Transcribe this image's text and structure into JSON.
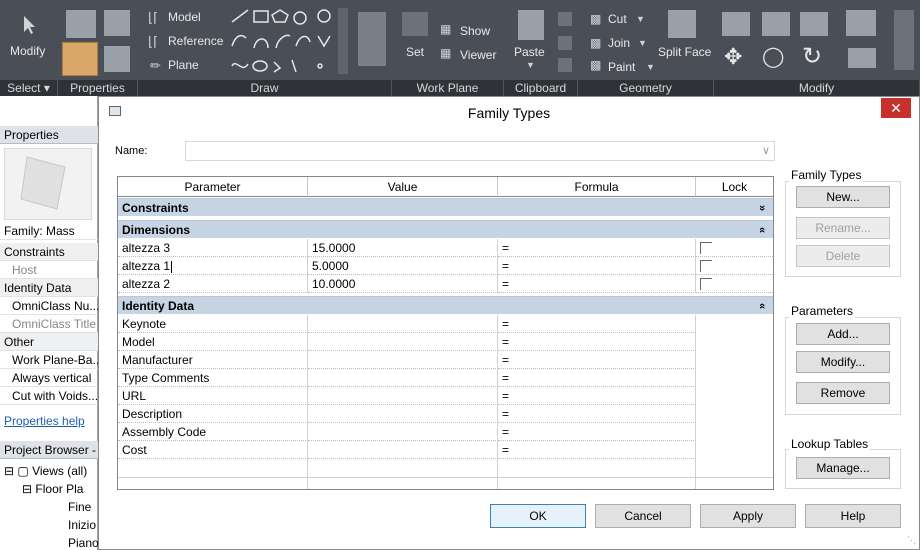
{
  "ribbon": {
    "modify_label": "Modify",
    "model_label": "Model",
    "reference_label": "Reference",
    "plane_label": "Plane",
    "show_label": "Show",
    "set_label": "Set",
    "viewer_label": "Viewer",
    "paste_label": "Paste",
    "cut_label": "Cut",
    "join_label": "Join",
    "paint_label": "Paint",
    "split_face_label": "Split Face",
    "groups": [
      "Select ▾",
      "Properties",
      "Draw",
      "Work Plane",
      "Clipboard",
      "Geometry",
      "Modify"
    ]
  },
  "properties_panel": {
    "title": "Properties",
    "family": "Family: Mass",
    "rows": [
      {
        "label": "Constraints",
        "kind": "cat"
      },
      {
        "label": "Host",
        "kind": "grey"
      },
      {
        "label": "Identity Data",
        "kind": "cat"
      },
      {
        "label": "OmniClass Nu...",
        "kind": "item"
      },
      {
        "label": "OmniClass Title",
        "kind": "grey"
      },
      {
        "label": "Other",
        "kind": "cat"
      },
      {
        "label": "Work Plane-Ba...",
        "kind": "item"
      },
      {
        "label": "Always vertical",
        "kind": "item"
      },
      {
        "label": "Cut with Voids...",
        "kind": "item"
      }
    ],
    "help_link": "Properties help"
  },
  "project_browser": {
    "title": "Project Browser - T",
    "items": [
      "Views (all)",
      "Floor Pla",
      "Fine",
      "Inizio",
      "Piano"
    ]
  },
  "dialog": {
    "title": "Family Types",
    "name_label": "Name:",
    "name_value": "",
    "columns": [
      "Parameter",
      "Value",
      "Formula",
      "Lock"
    ],
    "constraints_group": "Constraints",
    "dimensions_group": "Dimensions",
    "dimension_rows": [
      {
        "parameter": "altezza 3",
        "value": "15.0000",
        "formula": "="
      },
      {
        "parameter": "altezza 1",
        "value": "5.0000",
        "formula": "="
      },
      {
        "parameter": "altezza 2",
        "value": "10.0000",
        "formula": "="
      }
    ],
    "identity_group": "Identity Data",
    "identity_rows": [
      {
        "parameter": "Keynote",
        "formula": "="
      },
      {
        "parameter": "Model",
        "formula": "="
      },
      {
        "parameter": "Manufacturer",
        "formula": "="
      },
      {
        "parameter": "Type Comments",
        "formula": "="
      },
      {
        "parameter": "URL",
        "formula": "="
      },
      {
        "parameter": "Description",
        "formula": "="
      },
      {
        "parameter": "Assembly Code",
        "formula": "="
      },
      {
        "parameter": "Cost",
        "formula": "="
      }
    ],
    "family_types_group": "Family Types",
    "new_label": "New...",
    "rename_label": "Rename...",
    "delete_label": "Delete",
    "parameters_group": "Parameters",
    "add_label": "Add...",
    "modify_label": "Modify...",
    "remove_label": "Remove",
    "lookup_group": "Lookup Tables",
    "manage_label": "Manage...",
    "ok_label": "OK",
    "cancel_label": "Cancel",
    "apply_label": "Apply",
    "help_label": "Help"
  },
  "icons": {
    "close": "✕",
    "expand_down": "»",
    "collapse_up": "«",
    "dropdown": "∨"
  }
}
